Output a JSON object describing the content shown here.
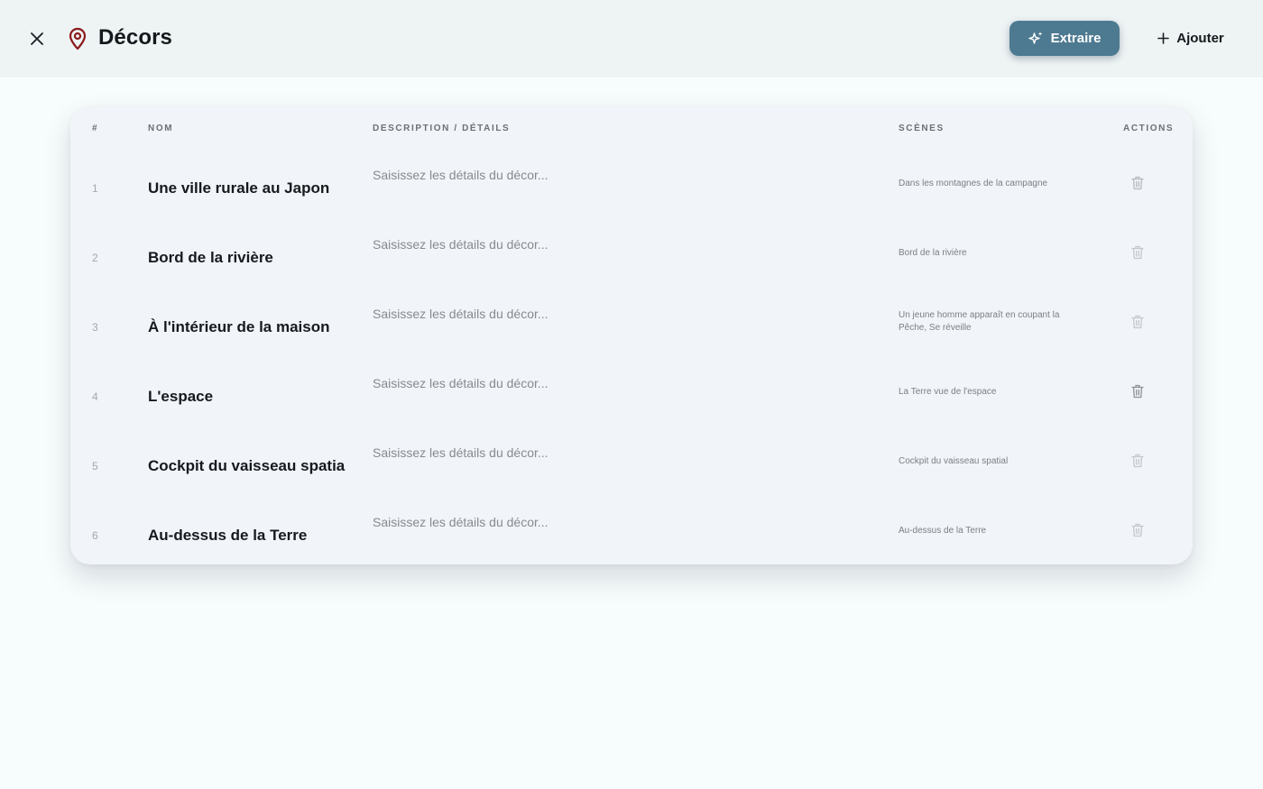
{
  "header": {
    "title": "Décors",
    "extract_label": "Extraire",
    "add_label": "Ajouter"
  },
  "table": {
    "columns": [
      "#",
      "NOM",
      "DESCRIPTION / DÉTAILS",
      "SCÈNES",
      "ACTIONS"
    ],
    "description_placeholder": "Saisissez les détails du décor...",
    "rows": [
      {
        "num": "1",
        "name": "Une ville rurale au Japon",
        "scenes": "Dans les montagnes de la campagne"
      },
      {
        "num": "2",
        "name": "Bord de la rivière",
        "scenes": "Bord de la rivière"
      },
      {
        "num": "3",
        "name": "À l'intérieur de la maison",
        "scenes": "Un jeune homme apparaît en coupant la Pêche, Se réveille"
      },
      {
        "num": "4",
        "name": "L'espace",
        "scenes": "La Terre vue de l'espace"
      },
      {
        "num": "5",
        "name": "Cockpit du vaisseau spatia",
        "scenes": "Cockpit du vaisseau spatial"
      },
      {
        "num": "6",
        "name": "Au-dessus de la Terre",
        "scenes": "Au-dessus de la Terre"
      }
    ]
  },
  "colors": {
    "accent": "#4d7a91",
    "pin": "#8b1a1a"
  },
  "icons": {
    "close": "close-icon",
    "location": "map-pin-icon",
    "sparkle": "sparkles-icon",
    "plus": "plus-icon",
    "delete": "trash-icon"
  }
}
